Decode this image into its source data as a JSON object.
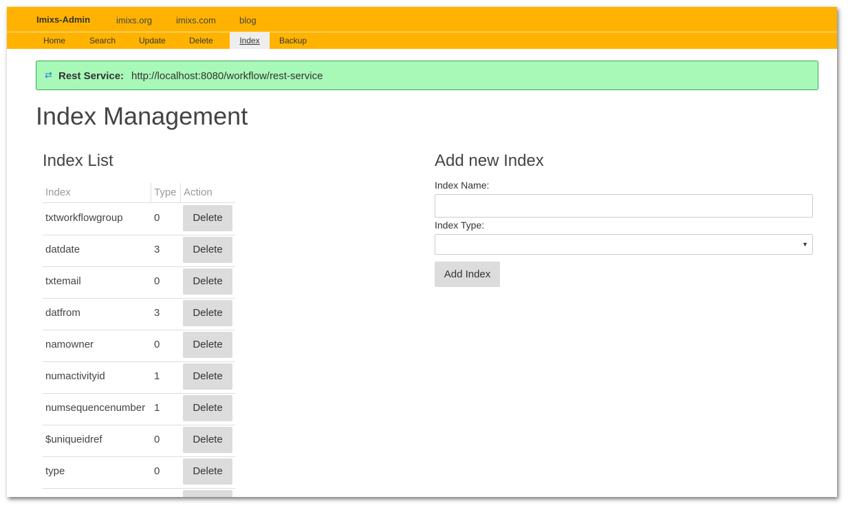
{
  "header": {
    "brand": "Imixs-Admin",
    "links": [
      "imixs.org",
      "imixs.com",
      "blog"
    ]
  },
  "nav": {
    "items": [
      "Home",
      "Search",
      "Update",
      "Delete",
      "Index",
      "Backup"
    ],
    "active": "Index"
  },
  "alert": {
    "icon": "exchange-icon",
    "label": "Rest Service:",
    "url": "http://localhost:8080/workflow/rest-service",
    "bg_color": "#a8f8b8",
    "border_color": "#34a853"
  },
  "page_title": "Index Management",
  "index_list": {
    "title": "Index List",
    "columns": [
      "Index",
      "Type",
      "Action"
    ],
    "delete_label": "Delete",
    "rows": [
      {
        "name": "txtworkflowgroup",
        "type": "0"
      },
      {
        "name": "datdate",
        "type": "3"
      },
      {
        "name": "txtemail",
        "type": "0"
      },
      {
        "name": "datfrom",
        "type": "3"
      },
      {
        "name": "namowner",
        "type": "0"
      },
      {
        "name": "numactivityid",
        "type": "1"
      },
      {
        "name": "numsequencenumber",
        "type": "1"
      },
      {
        "name": "$uniqueidref",
        "type": "0"
      },
      {
        "name": "type",
        "type": "0"
      }
    ]
  },
  "add_index": {
    "title": "Add new Index",
    "name_label": "Index Name:",
    "name_value": "",
    "type_label": "Index Type:",
    "type_value": "",
    "button_label": "Add Index"
  },
  "colors": {
    "nav_bar": "#ffb300",
    "button": "#dcdcdc"
  }
}
